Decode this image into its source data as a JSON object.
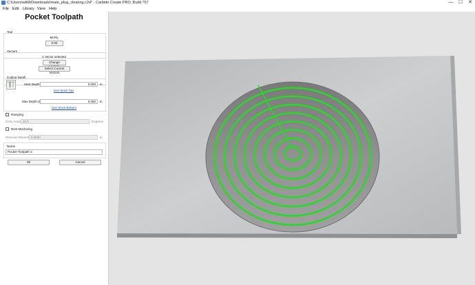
{
  "window": {
    "title": "C:\\Users\\willd\\Downloads\\male_plug_clearing.c2d* - Carbide Create PRO, Build 757",
    "buttons": {
      "minimize": "—",
      "maximize": "☐",
      "close": "✕"
    }
  },
  "menu": {
    "items": [
      "File",
      "Edit",
      "Library",
      "View",
      "Help"
    ]
  },
  "panel": {
    "title": "Pocket Toolpath",
    "tool": {
      "label": "Tool",
      "name": "McFly",
      "value": "0.00"
    },
    "vectors": {
      "label": "Vectors",
      "selected_text": "1 Vector selected",
      "change_button": "Change Vectors",
      "select_current_button": "Select Current Vectors"
    },
    "cutting_depth": {
      "label": "Cutting Depth",
      "start_label": "Start Depth (S)",
      "start_value": "0.000",
      "start_unit": "in",
      "use_stock_top": "Use Stock Top",
      "max_label": "Max Depth (D)",
      "max_value": "0.250",
      "max_unit": "in",
      "use_stock_bottom": "Use Stock Bottom"
    },
    "ramping": {
      "label": "Ramping",
      "checked": false,
      "entry_angle_label": "Entry Angle",
      "entry_angle_value": "30.0",
      "entry_angle_unit": "Degrees"
    },
    "rest_machining": {
      "label": "Rest Machining",
      "checked": false,
      "prev_diameter_label": "Previous Diameter",
      "prev_diameter_value": "0.2500",
      "prev_diameter_unit": "in"
    },
    "name": {
      "label": "Name",
      "value": "Pocket Toolpath 3"
    },
    "ok_button": "Ok",
    "cancel_button": "Cancel"
  },
  "viewport": {
    "colors": {
      "background": "#e4e4e4",
      "stock_top": "#c3c5c7",
      "pocket": "#8c8c8c",
      "toolpath": "#22dd22"
    },
    "toolpath_rings": 8
  }
}
